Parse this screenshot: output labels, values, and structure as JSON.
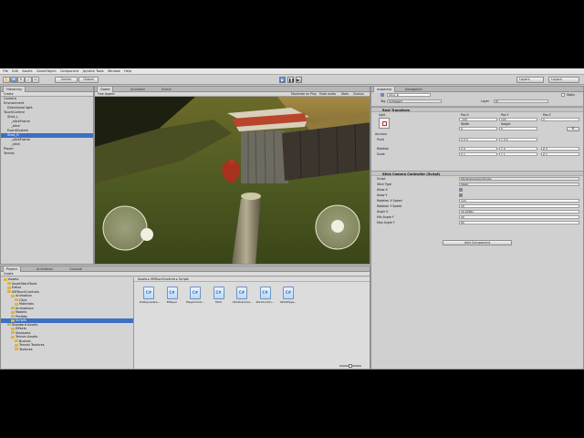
{
  "menu": [
    "File",
    "Edit",
    "Assets",
    "GameObject",
    "Component",
    "Joystick Tools",
    "Window",
    "Help"
  ],
  "toolbar": {
    "pivot": "Center",
    "space": "Global",
    "layers": "Layers",
    "layout": "Layout"
  },
  "hierarchy": {
    "tab": "Hierarchy",
    "create": "Create",
    "items": [
      {
        "label": "Camera",
        "indent": 0,
        "selected": false
      },
      {
        "label": "Environment",
        "indent": 0,
        "selected": false
      },
      {
        "label": "Directional light",
        "indent": 1,
        "selected": false
      },
      {
        "label": "TouchControl",
        "indent": 0,
        "selected": false
      },
      {
        "label": "Stick_L",
        "indent": 1,
        "selected": false
      },
      {
        "label": "_stickFrame",
        "indent": 2,
        "selected": false
      },
      {
        "label": "_stick",
        "indent": 2,
        "selected": false
      },
      {
        "label": "EventSystem",
        "indent": 1,
        "selected": false
      },
      {
        "label": "Stick_R",
        "indent": 1,
        "selected": true
      },
      {
        "label": "_stickFrame",
        "indent": 2,
        "selected": false
      },
      {
        "label": "_stick",
        "indent": 2,
        "selected": false
      },
      {
        "label": "Player",
        "indent": 0,
        "selected": false
      },
      {
        "label": "Terrain",
        "indent": 0,
        "selected": false
      }
    ]
  },
  "game": {
    "tabs": [
      "Game",
      "Animator",
      "Scene"
    ],
    "aspect": "Free Aspect",
    "options": [
      "Maximize on Play",
      "Mute audio",
      "Stats",
      "Gizmos"
    ]
  },
  "project": {
    "tabs": [
      "Project",
      "Animation",
      "Console"
    ],
    "create": "Create",
    "breadcrumb": [
      "Assets",
      "SMTouchControls",
      "Scripts"
    ],
    "tree": [
      {
        "label": "Assets",
        "indent": 0
      },
      {
        "label": "AssetStoreTools",
        "indent": 1
      },
      {
        "label": "Editor",
        "indent": 1
      },
      {
        "label": "SMTouchControls",
        "indent": 1
      },
      {
        "label": "Animation",
        "indent": 2
      },
      {
        "label": "Clips",
        "indent": 3
      },
      {
        "label": "Materials",
        "indent": 3
      },
      {
        "label": "Animations",
        "indent": 2
      },
      {
        "label": "Models",
        "indent": 2
      },
      {
        "label": "Prefabs",
        "indent": 2
      },
      {
        "label": "Scripts",
        "indent": 2
      },
      {
        "label": "Standard Assets",
        "indent": 1
      },
      {
        "label": "Effects",
        "indent": 2
      },
      {
        "label": "Skyboxes",
        "indent": 2
      },
      {
        "label": "Terrain Assets",
        "indent": 2
      },
      {
        "label": "Bushes",
        "indent": 3
      },
      {
        "label": "Terrain Textures",
        "indent": 3
      },
      {
        "label": "Textures",
        "indent": 3
      }
    ],
    "assets": [
      "DoRaycastLa...",
      "EPlayer",
      "PlayerContr...",
      "Stick",
      "StickCamera...",
      "StickContro...",
      "StickPlaye..."
    ]
  },
  "inspector": {
    "tabs": [
      "Inspector",
      "Navigation"
    ],
    "object_name": "Stick_R",
    "static": "Static",
    "tag_label": "Tag",
    "tag_value": "Untagged",
    "layer_label": "Layer",
    "layer_value": "UI",
    "rect": {
      "title": "Rect Transform",
      "anchor_label": "right",
      "pos_headers": [
        "Pos X",
        "Pos Y",
        "Pos Z"
      ],
      "pos_values": [
        "-100",
        "100",
        "0"
      ],
      "size_headers": [
        "Width",
        "Height"
      ],
      "size_values": [
        "0",
        "0"
      ],
      "anchors": "Anchors",
      "pivot_label": "Pivot",
      "pivot_values": [
        "X 0.5",
        "Y 0.5"
      ],
      "rotation_label": "Rotation",
      "rotation_values": [
        "X 0",
        "Y 0",
        "Z 0"
      ],
      "scale_label": "Scale",
      "scale_values": [
        "X 1",
        "Y 1",
        "Z 1"
      ]
    },
    "script_comp": {
      "title": "Stick Camera Controller (Script)",
      "rows": [
        {
          "label": "Script",
          "value": "StickCameraController"
        },
        {
          "label": "Stick Type",
          "value": "Static"
        },
        {
          "label": "Allow X",
          "value": ""
        },
        {
          "label": "Allow Y",
          "value": ""
        },
        {
          "label": "Rotation X Speed",
          "value": "120"
        },
        {
          "label": "Rotation Y Speed",
          "value": "20"
        },
        {
          "label": "Angle X",
          "value": "40.00841"
        },
        {
          "label": "Min Angle Y",
          "value": "20"
        },
        {
          "label": "Max Angle Y",
          "value": "60"
        }
      ]
    },
    "add_component": "Add Component"
  },
  "colors": {
    "accent": "#3d6fc4",
    "panel": "#d0d0d0"
  }
}
